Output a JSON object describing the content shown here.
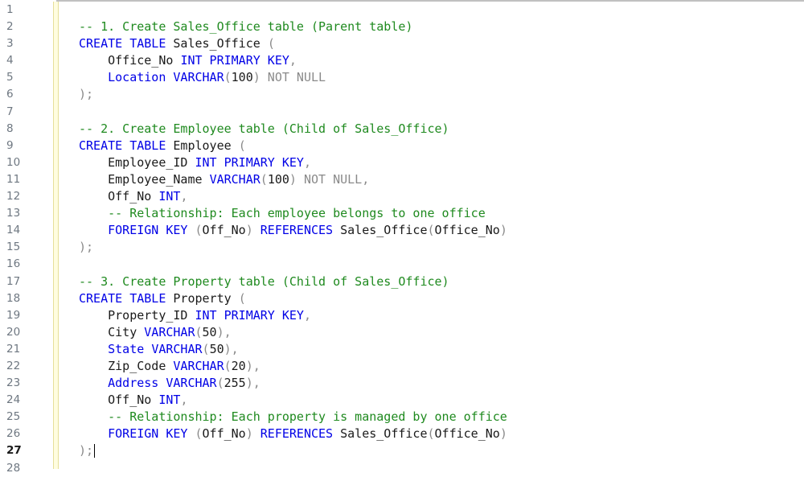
{
  "editor": {
    "current_line": 27,
    "lines": [
      {
        "n": "1",
        "indent": "",
        "tokens": []
      },
      {
        "n": "2",
        "indent": "",
        "tokens": [
          {
            "t": "-- 1. Create Sales_Office table (Parent table)",
            "c": "cm"
          }
        ]
      },
      {
        "n": "3",
        "indent": "",
        "tokens": [
          {
            "t": "CREATE TABLE",
            "c": "kw"
          },
          {
            "t": " Sales_Office ",
            "c": ""
          },
          {
            "t": "(",
            "c": "gr"
          }
        ]
      },
      {
        "n": "4",
        "indent": "    ",
        "tokens": [
          {
            "t": "Office_No ",
            "c": ""
          },
          {
            "t": "INT PRIMARY KEY",
            "c": "kw"
          },
          {
            "t": ",",
            "c": "gr"
          }
        ]
      },
      {
        "n": "5",
        "indent": "    ",
        "tokens": [
          {
            "t": "Location ",
            "c": "kw"
          },
          {
            "t": "VARCHAR",
            "c": "kw"
          },
          {
            "t": "(",
            "c": "gr"
          },
          {
            "t": "100",
            "c": ""
          },
          {
            "t": ") NOT NULL",
            "c": "gr"
          }
        ]
      },
      {
        "n": "6",
        "indent": "",
        "tokens": [
          {
            "t": ");",
            "c": "gr"
          }
        ]
      },
      {
        "n": "7",
        "indent": "",
        "tokens": []
      },
      {
        "n": "8",
        "indent": "",
        "tokens": [
          {
            "t": "-- 2. Create Employee table (Child of Sales_Office)",
            "c": "cm"
          }
        ]
      },
      {
        "n": "9",
        "indent": "",
        "tokens": [
          {
            "t": "CREATE TABLE",
            "c": "kw"
          },
          {
            "t": " Employee ",
            "c": ""
          },
          {
            "t": "(",
            "c": "gr"
          }
        ]
      },
      {
        "n": "10",
        "indent": "    ",
        "tokens": [
          {
            "t": "Employee_ID ",
            "c": ""
          },
          {
            "t": "INT PRIMARY KEY",
            "c": "kw"
          },
          {
            "t": ",",
            "c": "gr"
          }
        ]
      },
      {
        "n": "11",
        "indent": "    ",
        "tokens": [
          {
            "t": "Employee_Name ",
            "c": ""
          },
          {
            "t": "VARCHAR",
            "c": "kw"
          },
          {
            "t": "(",
            "c": "gr"
          },
          {
            "t": "100",
            "c": ""
          },
          {
            "t": ") NOT NULL,",
            "c": "gr"
          }
        ]
      },
      {
        "n": "12",
        "indent": "    ",
        "tokens": [
          {
            "t": "Off_No ",
            "c": ""
          },
          {
            "t": "INT",
            "c": "kw"
          },
          {
            "t": ",",
            "c": "gr"
          }
        ]
      },
      {
        "n": "13",
        "indent": "    ",
        "tokens": [
          {
            "t": "-- Relationship: Each employee belongs to one office",
            "c": "cm"
          }
        ]
      },
      {
        "n": "14",
        "indent": "    ",
        "tokens": [
          {
            "t": "FOREIGN KEY",
            "c": "kw"
          },
          {
            "t": " (",
            "c": "gr"
          },
          {
            "t": "Off_No",
            "c": ""
          },
          {
            "t": ") ",
            "c": "gr"
          },
          {
            "t": "REFERENCES",
            "c": "kw"
          },
          {
            "t": " Sales_Office",
            "c": ""
          },
          {
            "t": "(",
            "c": "gr"
          },
          {
            "t": "Office_No",
            "c": ""
          },
          {
            "t": ")",
            "c": "gr"
          }
        ]
      },
      {
        "n": "15",
        "indent": "",
        "tokens": [
          {
            "t": ");",
            "c": "gr"
          }
        ]
      },
      {
        "n": "16",
        "indent": "",
        "tokens": []
      },
      {
        "n": "17",
        "indent": "",
        "tokens": [
          {
            "t": "-- 3. Create Property table (Child of Sales_Office)",
            "c": "cm"
          }
        ]
      },
      {
        "n": "18",
        "indent": "",
        "tokens": [
          {
            "t": "CREATE TABLE",
            "c": "kw"
          },
          {
            "t": " Property ",
            "c": ""
          },
          {
            "t": "(",
            "c": "gr"
          }
        ]
      },
      {
        "n": "19",
        "indent": "    ",
        "tokens": [
          {
            "t": "Property_ID ",
            "c": ""
          },
          {
            "t": "INT PRIMARY KEY",
            "c": "kw"
          },
          {
            "t": ",",
            "c": "gr"
          }
        ]
      },
      {
        "n": "20",
        "indent": "    ",
        "tokens": [
          {
            "t": "City ",
            "c": ""
          },
          {
            "t": "VARCHAR",
            "c": "kw"
          },
          {
            "t": "(",
            "c": "gr"
          },
          {
            "t": "50",
            "c": ""
          },
          {
            "t": "),",
            "c": "gr"
          }
        ]
      },
      {
        "n": "21",
        "indent": "    ",
        "tokens": [
          {
            "t": "State ",
            "c": "kw"
          },
          {
            "t": "VARCHAR",
            "c": "kw"
          },
          {
            "t": "(",
            "c": "gr"
          },
          {
            "t": "50",
            "c": ""
          },
          {
            "t": "),",
            "c": "gr"
          }
        ]
      },
      {
        "n": "22",
        "indent": "    ",
        "tokens": [
          {
            "t": "Zip_Code ",
            "c": ""
          },
          {
            "t": "VARCHAR",
            "c": "kw"
          },
          {
            "t": "(",
            "c": "gr"
          },
          {
            "t": "20",
            "c": ""
          },
          {
            "t": "),",
            "c": "gr"
          }
        ]
      },
      {
        "n": "23",
        "indent": "    ",
        "tokens": [
          {
            "t": "Address ",
            "c": "kw"
          },
          {
            "t": "VARCHAR",
            "c": "kw"
          },
          {
            "t": "(",
            "c": "gr"
          },
          {
            "t": "255",
            "c": ""
          },
          {
            "t": "),",
            "c": "gr"
          }
        ]
      },
      {
        "n": "24",
        "indent": "    ",
        "tokens": [
          {
            "t": "Off_No ",
            "c": ""
          },
          {
            "t": "INT",
            "c": "kw"
          },
          {
            "t": ",",
            "c": "gr"
          }
        ]
      },
      {
        "n": "25",
        "indent": "    ",
        "tokens": [
          {
            "t": "-- Relationship: Each property is managed by one office",
            "c": "cm"
          }
        ]
      },
      {
        "n": "26",
        "indent": "    ",
        "tokens": [
          {
            "t": "FOREIGN KEY",
            "c": "kw"
          },
          {
            "t": " (",
            "c": "gr"
          },
          {
            "t": "Off_No",
            "c": ""
          },
          {
            "t": ") ",
            "c": "gr"
          },
          {
            "t": "REFERENCES",
            "c": "kw"
          },
          {
            "t": " Sales_Office",
            "c": ""
          },
          {
            "t": "(",
            "c": "gr"
          },
          {
            "t": "Office_No",
            "c": ""
          },
          {
            "t": ")",
            "c": "gr"
          }
        ]
      },
      {
        "n": "27",
        "indent": "",
        "tokens": [
          {
            "t": ");",
            "c": "gr"
          }
        ]
      },
      {
        "n": "28",
        "indent": "",
        "tokens": []
      }
    ]
  },
  "colors": {
    "keyword": "#0000e6",
    "comment": "#1f8a1f",
    "punctuation": "#8a8a8a",
    "text": "#1a1a1a",
    "changebar": "#fffde0"
  }
}
